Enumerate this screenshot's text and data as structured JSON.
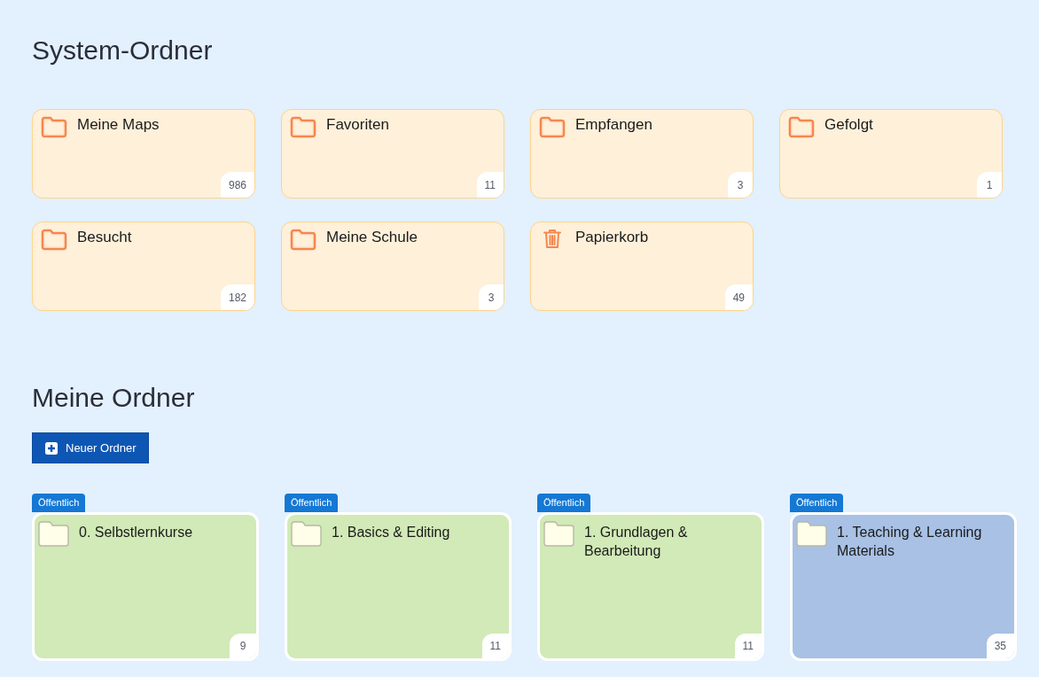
{
  "system_folders": {
    "title": "System-Ordner",
    "items": [
      {
        "kind": "folder",
        "name": "Meine Maps",
        "count": "986"
      },
      {
        "kind": "folder",
        "name": "Favoriten",
        "count": "11"
      },
      {
        "kind": "folder",
        "name": "Empfangen",
        "count": "3"
      },
      {
        "kind": "folder",
        "name": "Gefolgt",
        "count": "1"
      },
      {
        "kind": "folder",
        "name": "Besucht",
        "count": "182"
      },
      {
        "kind": "folder",
        "name": "Meine Schule",
        "count": "3"
      },
      {
        "kind": "trash",
        "name": "Papierkorb",
        "count": "49"
      }
    ]
  },
  "my_folders": {
    "title": "Meine Ordner",
    "new_button": "Neuer Ordner",
    "items": [
      {
        "tag": "Öffentlich",
        "name": "0. Selbstlernkurse",
        "count": "9",
        "color": "#d1eab7"
      },
      {
        "tag": "Öffentlich",
        "name": "1. Basics & Editing",
        "count": "11",
        "color": "#d1eab7"
      },
      {
        "tag": "Öffentlich",
        "name": "1. Grundlagen & Bearbeitung",
        "count": "11",
        "color": "#d1eab7"
      },
      {
        "tag": "Öffentlich",
        "name": "1. Teaching & Learning Materials",
        "count": "35",
        "color": "#a8c1e5"
      }
    ]
  }
}
